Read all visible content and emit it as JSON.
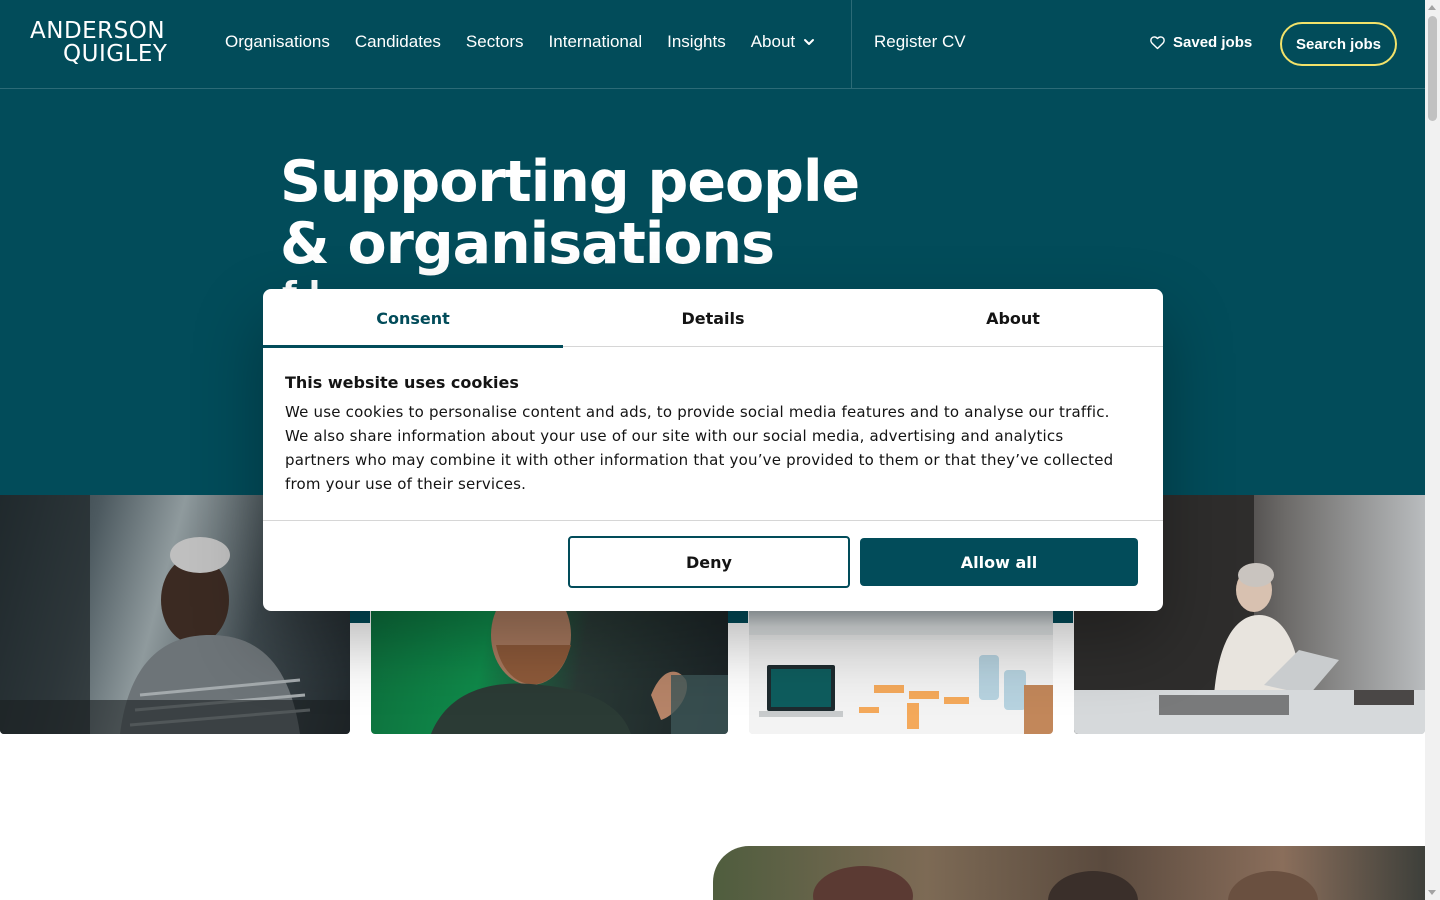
{
  "header": {
    "logo": {
      "line1": "ANDERSON",
      "line2": "QUIGLEY"
    },
    "nav": [
      {
        "label": "Organisations"
      },
      {
        "label": "Candidates"
      },
      {
        "label": "Sectors"
      },
      {
        "label": "International"
      },
      {
        "label": "Insights"
      },
      {
        "label": "About",
        "icon": "chevron-down-icon"
      }
    ],
    "register_label": "Register CV",
    "saved_jobs_label": "Saved jobs",
    "saved_jobs_icon": "heart-icon",
    "search_jobs_label": "Search jobs"
  },
  "hero": {
    "title_line1": "Supporting people",
    "title_line2": "& organisations",
    "subtitle_partial": "f                 l"
  },
  "cookie_dialog": {
    "tabs": [
      {
        "label": "Consent",
        "active": true
      },
      {
        "label": "Details",
        "active": false
      },
      {
        "label": "About",
        "active": false
      }
    ],
    "title": "This website uses cookies",
    "body": "We use cookies to personalise content and ads, to provide social media features and to analyse our traffic. We also share information about your use of our site with our social media, advertising and analytics partners who may combine it with other information that you’ve provided to them or that they’ve collected from your use of their services.",
    "deny_label": "Deny",
    "allow_label": "Allow all"
  },
  "colors": {
    "brand_teal": "#024c5a",
    "accent_yellow": "#f2e26a",
    "text_dark": "#141414",
    "white": "#ffffff"
  }
}
